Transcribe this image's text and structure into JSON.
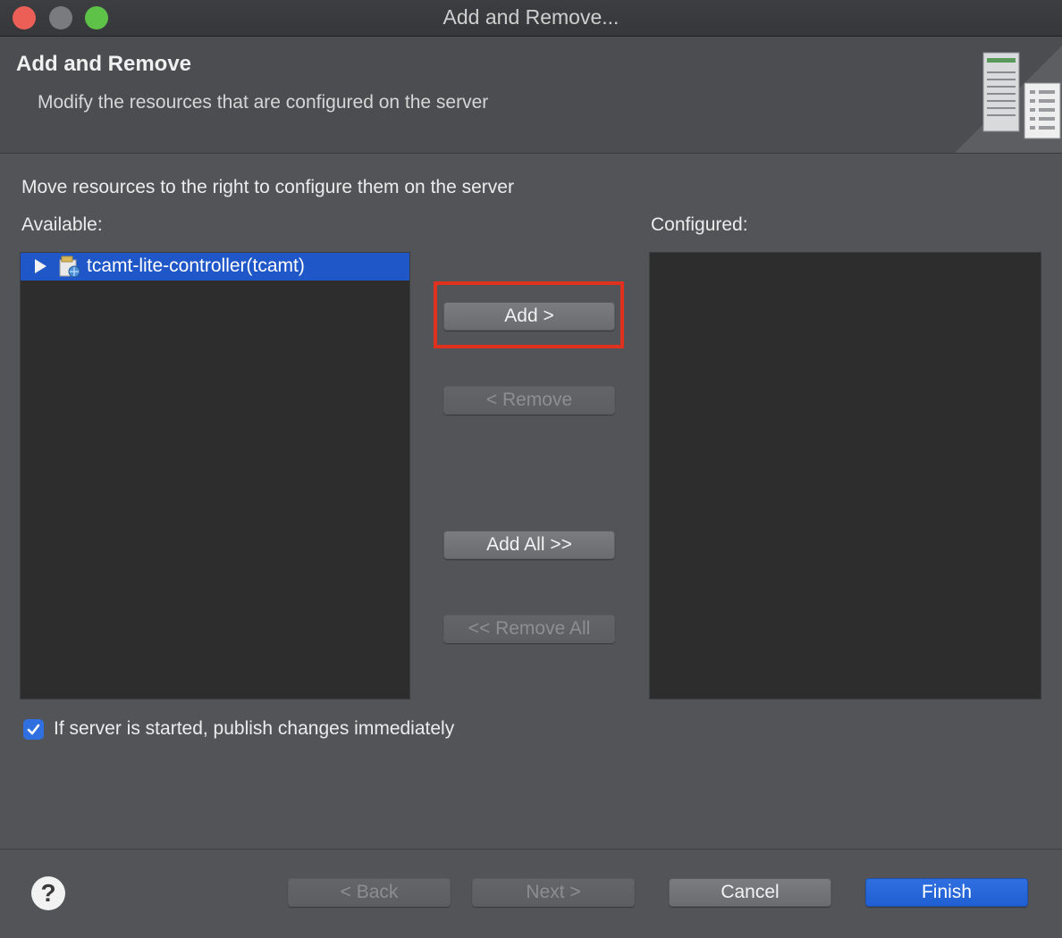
{
  "window": {
    "title": "Add and Remove..."
  },
  "banner": {
    "title": "Add and Remove",
    "subtitle": "Modify the resources that are configured on the server",
    "icon": "server-wizard-icon"
  },
  "main": {
    "instruction": "Move resources to the right to configure them on the server",
    "available_label": "Available:",
    "configured_label": "Configured:",
    "available_items": [
      {
        "label": "tcamt-lite-controller(tcamt)",
        "icon": "web-project-icon",
        "selected": true,
        "expanded": false
      }
    ],
    "configured_items": []
  },
  "transfer_buttons": {
    "add": "Add >",
    "remove": "< Remove",
    "add_all": "Add All >>",
    "remove_all": "<< Remove All"
  },
  "options": {
    "publish_immediately_label": "If server is started, publish changes immediately",
    "publish_immediately_checked": true
  },
  "footer": {
    "help": "?",
    "back": "< Back",
    "next": "Next >",
    "cancel": "Cancel",
    "finish": "Finish"
  },
  "colors": {
    "accent": "#1f5fd3",
    "highlight_box": "#e0301e",
    "selection": "#1f57c8"
  }
}
